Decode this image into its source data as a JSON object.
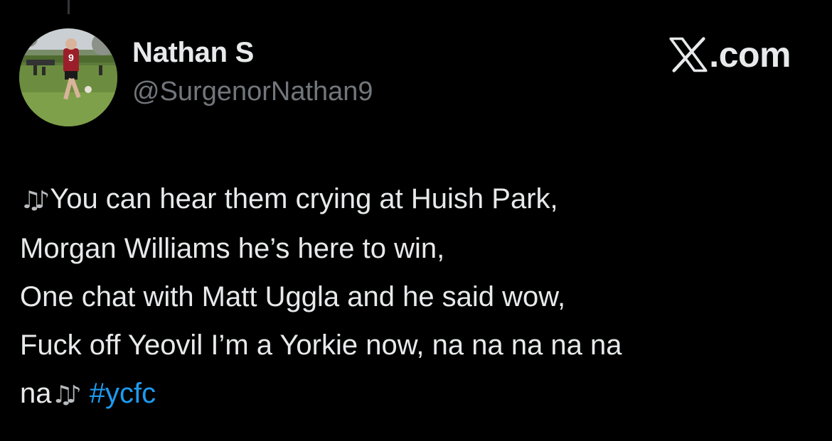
{
  "author": {
    "display_name": "Nathan S",
    "handle": "@SurgenorNathan9",
    "avatar_jersey_number": "9"
  },
  "brand": {
    "label": ".com",
    "icon": "x-logo-icon"
  },
  "tweet": {
    "lines": [
      "You can hear them crying at Huish Park,",
      "Morgan Williams he’s here to win,",
      "One chat with Matt Uggla and he said wow,",
      "Fuck off Yeovil I’m a Yorkie now, na na na na na",
      "na"
    ],
    "note_emoji": "♫♪",
    "hashtag": "#ycfc"
  },
  "colors": {
    "background": "#000000",
    "text": "#e7e9ea",
    "secondary_text": "#71767b",
    "link": "#1d9bf0"
  }
}
